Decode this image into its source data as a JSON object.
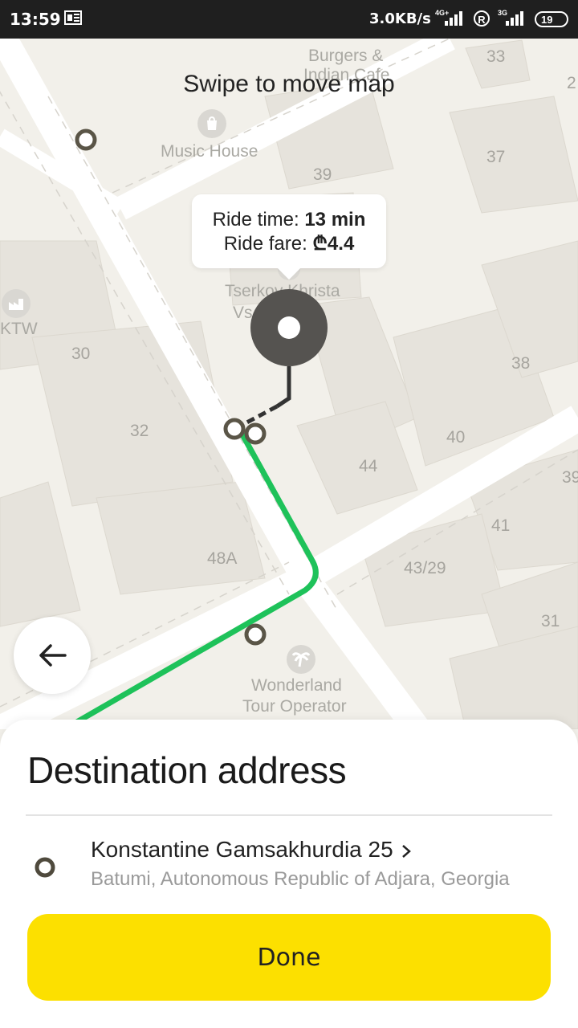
{
  "status_bar": {
    "time": "13:59",
    "speed": "3.0KB/s",
    "net1": "4G+",
    "net2": "3G",
    "roaming": "R",
    "battery": "19"
  },
  "map": {
    "hint": "Swipe to move map",
    "pois": {
      "burgers": "Burgers &",
      "burgers2": "Indian Cafe",
      "music": "Music House",
      "church1": "Tserkov Khrista",
      "church2": "Vs...lya",
      "ktw": "KTW",
      "wonderland1": "Wonderland",
      "wonderland2": "Tour Operator"
    },
    "house_numbers": [
      "33",
      "37",
      "39",
      "30",
      "32",
      "38",
      "40",
      "44",
      "41",
      "43/29",
      "48A",
      "31",
      "2",
      "39"
    ]
  },
  "ride": {
    "time_label": "Ride time: ",
    "time_value": "13 min",
    "fare_label": "Ride fare: ",
    "fare_value": "₾4.4"
  },
  "sheet": {
    "title": "Destination address",
    "address_name": "Konstantine Gamsakhurdia 25",
    "address_sub": "Batumi, Autonomous Republic of Adjara, Georgia",
    "done_label": "Done"
  },
  "colors": {
    "route": "#22c55e",
    "accent": "#fce000",
    "pin": "#555350"
  },
  "icons": {
    "back": "arrow-left-icon",
    "chevron": "chevron-right-icon",
    "shop": "shopping-bag-icon",
    "factory": "factory-icon",
    "palm": "palm-tree-icon"
  }
}
